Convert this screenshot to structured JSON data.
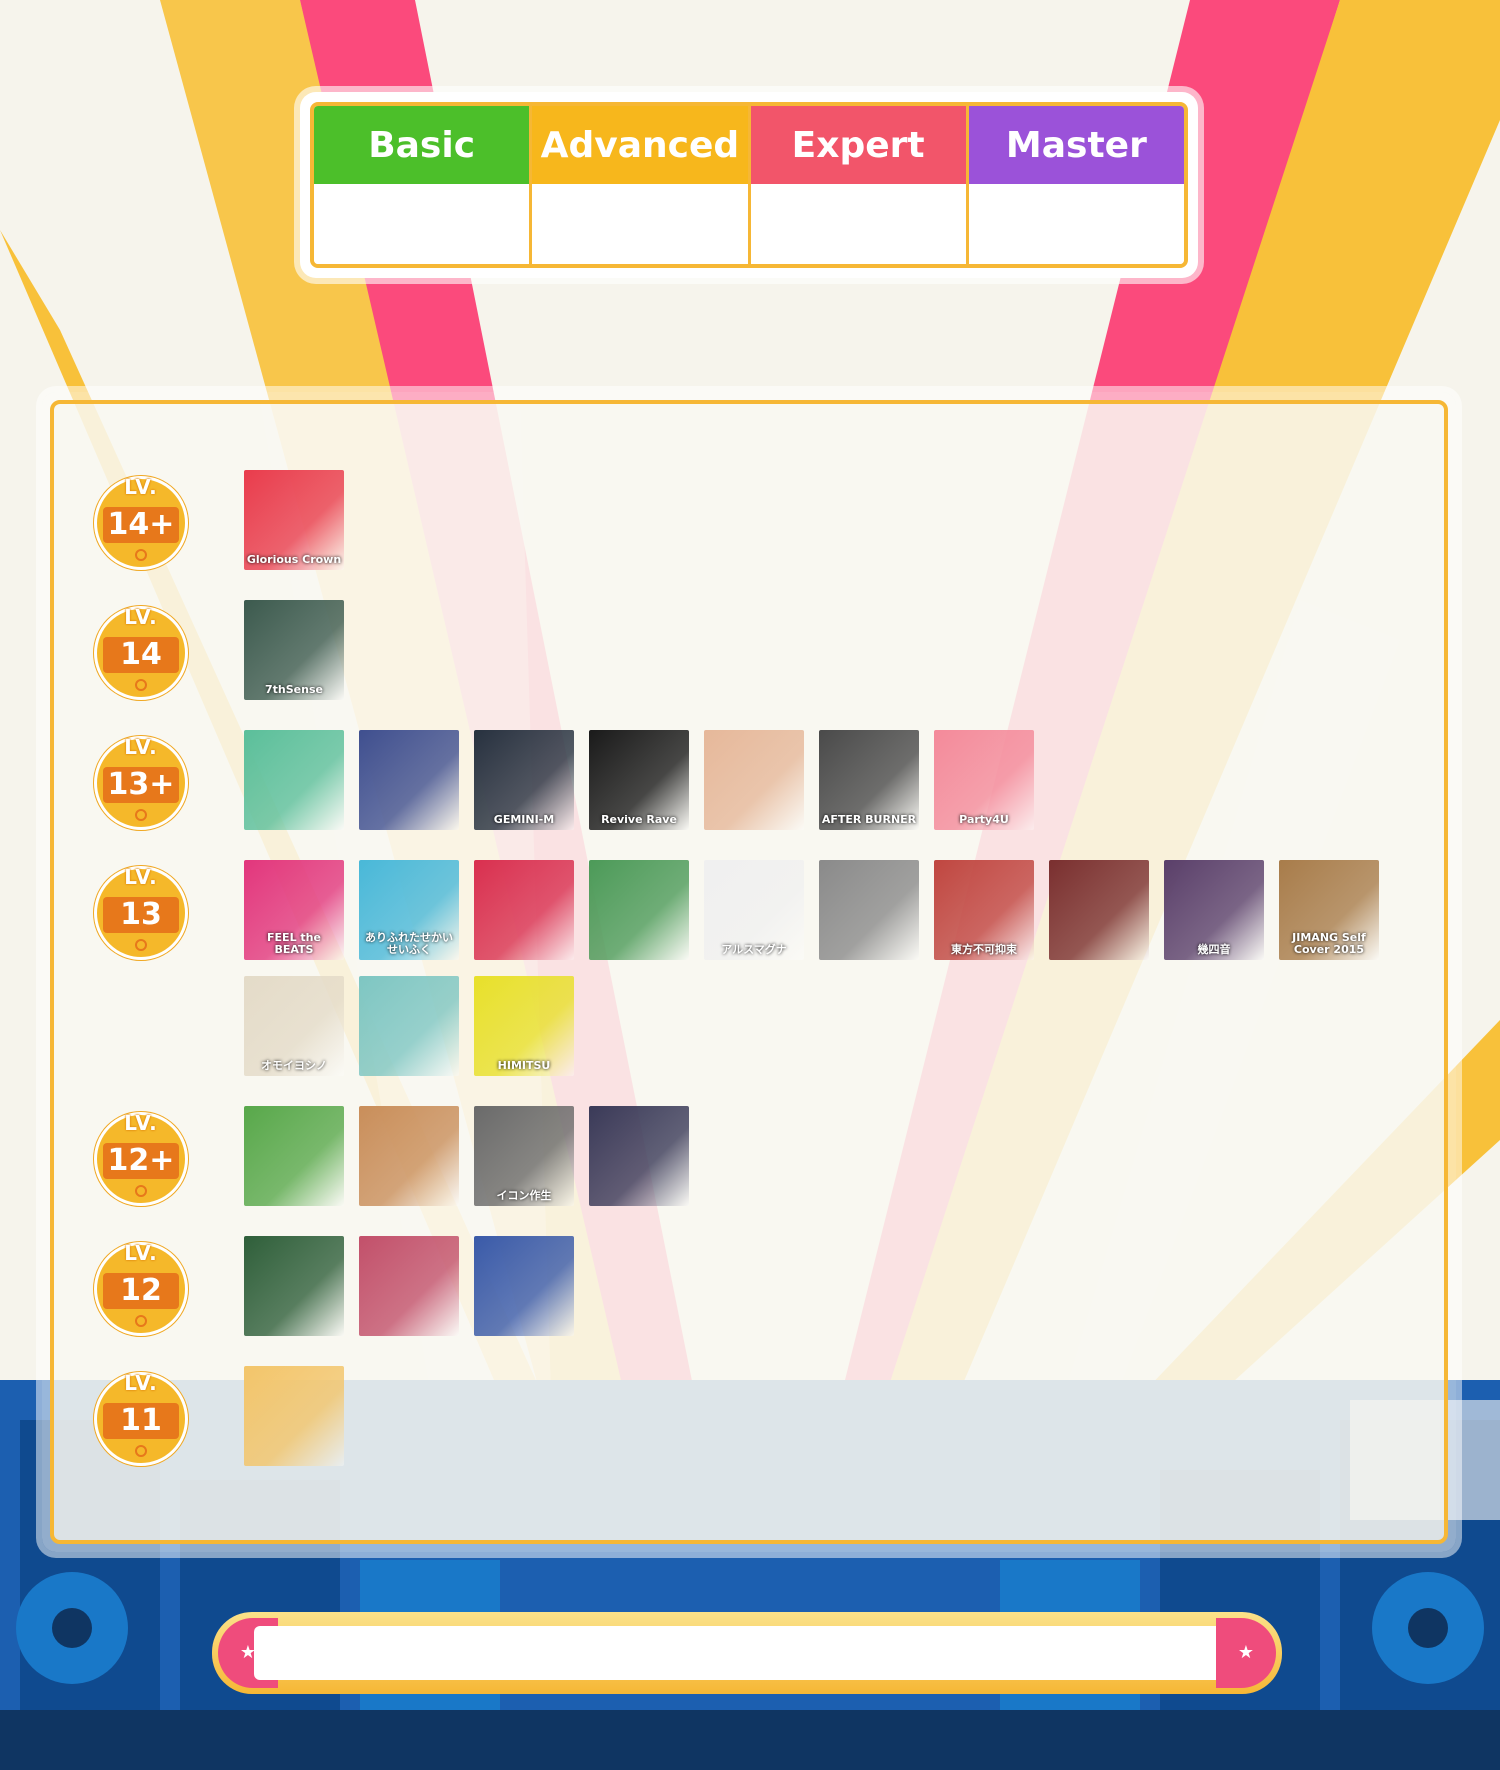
{
  "difficulties": [
    {
      "label": "Basic",
      "color": "#4cbf2a"
    },
    {
      "label": "Advanced",
      "color": "#f7b71c"
    },
    {
      "label": "Expert",
      "color": "#f2556a"
    },
    {
      "label": "Master",
      "color": "#9b52d9"
    }
  ],
  "level_badge_prefix": "LV.",
  "levels": [
    {
      "level": "14+",
      "covers": [
        {
          "title": "Glorious Crown",
          "color": "#e93c4c"
        }
      ]
    },
    {
      "level": "14",
      "covers": [
        {
          "title": "7thSense",
          "color": "#3c5a4e"
        }
      ]
    },
    {
      "level": "13+",
      "covers": [
        {
          "title": "",
          "color": "#5bbf9a"
        },
        {
          "title": "",
          "color": "#3f4f8f"
        },
        {
          "title": "GEMINI-M",
          "color": "#27313f"
        },
        {
          "title": "Revive Rave",
          "color": "#1a1a1a"
        },
        {
          "title": "",
          "color": "#e6b89a"
        },
        {
          "title": "AFTER BURNER",
          "color": "#4a4a4a"
        },
        {
          "title": "Party4U",
          "color": "#f48a9a"
        }
      ]
    },
    {
      "level": "13",
      "covers": [
        {
          "title": "FEEL the BEATS",
          "color": "#e2367c"
        },
        {
          "title": "ありふれたせかいせいふく",
          "color": "#49b8d8"
        },
        {
          "title": "",
          "color": "#d92f4f"
        },
        {
          "title": "",
          "color": "#4c9a58"
        },
        {
          "title": "アルスマグナ",
          "color": "#f0f0f0"
        },
        {
          "title": "",
          "color": "#8a8a8a"
        },
        {
          "title": "東方不可抑束",
          "color": "#c04640"
        },
        {
          "title": "",
          "color": "#7a2f2f"
        },
        {
          "title": "幾四音",
          "color": "#5a3f6a"
        },
        {
          "title": "JIMANG Self Cover 2015",
          "color": "#a87c4a"
        },
        {
          "title": "オモイヨシノ",
          "color": "#e4dbc8"
        },
        {
          "title": "",
          "color": "#7ec6c2"
        },
        {
          "title": "HIMITSU",
          "color": "#e8e02a"
        }
      ]
    },
    {
      "level": "12+",
      "covers": [
        {
          "title": "",
          "color": "#58a84a"
        },
        {
          "title": "",
          "color": "#c98e5a"
        },
        {
          "title": "イコン作生",
          "color": "#6a6a6a"
        },
        {
          "title": "",
          "color": "#3a3a58"
        }
      ]
    },
    {
      "level": "12",
      "covers": [
        {
          "title": "",
          "color": "#2f5f3a"
        },
        {
          "title": "",
          "color": "#c2506a"
        },
        {
          "title": "",
          "color": "#3a5aa8"
        }
      ]
    },
    {
      "level": "11",
      "covers": [
        {
          "title": "",
          "color": "#f3c56a"
        }
      ]
    }
  ]
}
